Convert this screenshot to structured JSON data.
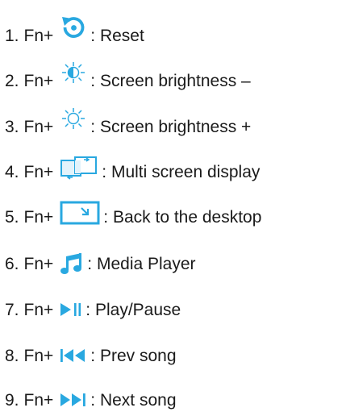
{
  "colors": {
    "icon": "#29a8e0",
    "text": "#1a1a1a"
  },
  "items": [
    {
      "number": "1.",
      "key": "Fn+",
      "icon": "reset-icon",
      "desc": ": Reset"
    },
    {
      "number": "2.",
      "key": "Fn+",
      "icon": "brightness-down-icon",
      "desc": ": Screen brightness –"
    },
    {
      "number": "3.",
      "key": "Fn+",
      "icon": "brightness-up-icon",
      "desc": ": Screen brightness +"
    },
    {
      "number": "4.",
      "key": "Fn+",
      "icon": "multi-screen-icon",
      "desc": ": Multi screen display"
    },
    {
      "number": "5.",
      "key": "Fn+",
      "icon": "desktop-icon",
      "desc": ": Back to the desktop"
    },
    {
      "number": "6.",
      "key": "Fn+",
      "icon": "music-note-icon",
      "desc": ": Media Player"
    },
    {
      "number": "7.",
      "key": "Fn+",
      "icon": "play-pause-icon",
      "desc": ": Play/Pause"
    },
    {
      "number": "8.",
      "key": "Fn+",
      "icon": "prev-song-icon",
      "desc": ": Prev song"
    },
    {
      "number": "9.",
      "key": "Fn+",
      "icon": "next-song-icon",
      "desc": ": Next song"
    }
  ]
}
